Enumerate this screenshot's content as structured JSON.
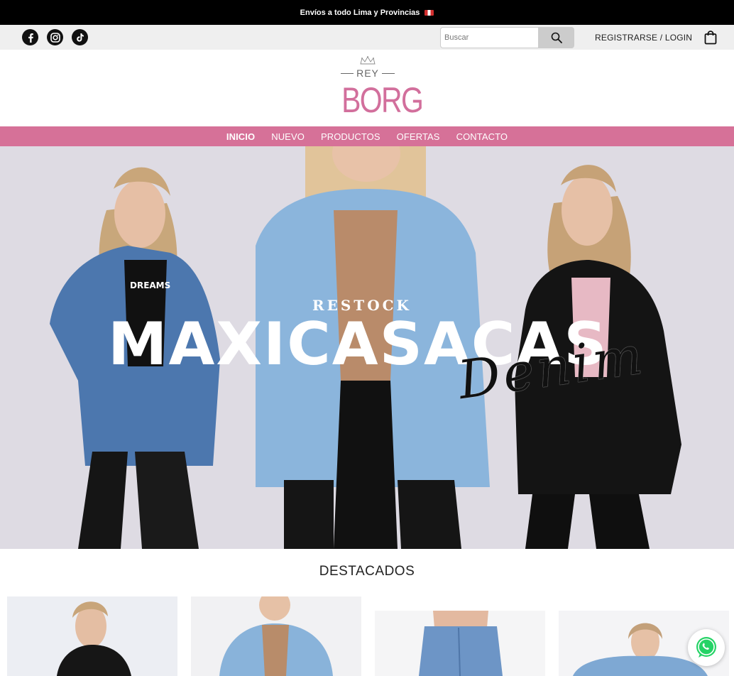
{
  "announcement": {
    "text": "Envíos a todo Lima y Provincias",
    "flag_icon": "peru-flag-icon"
  },
  "utility": {
    "social": [
      "facebook-icon",
      "instagram-icon",
      "tiktok-icon"
    ],
    "search_placeholder": "Buscar",
    "search_value": "",
    "login_label": "REGISTRARSE / LOGIN",
    "cart_icon": "shopping-bag-icon"
  },
  "brand": {
    "top": "REY",
    "name": "BORG",
    "color": "#d26f9c"
  },
  "nav": {
    "color": "#d67198",
    "items": [
      {
        "label": "INICIO",
        "active": true
      },
      {
        "label": "NUEVO"
      },
      {
        "label": "PRODUCTOS"
      },
      {
        "label": "OFERTAS"
      },
      {
        "label": "CONTACTO"
      }
    ]
  },
  "hero": {
    "kicker": "RESTOCK",
    "headline": "MAXICASACAS",
    "script": "Denim",
    "shirt_text_left": "DREAMS"
  },
  "featured": {
    "title": "DESTACADOS"
  },
  "whatsapp": {
    "icon": "whatsapp-icon",
    "color": "#25d366"
  }
}
